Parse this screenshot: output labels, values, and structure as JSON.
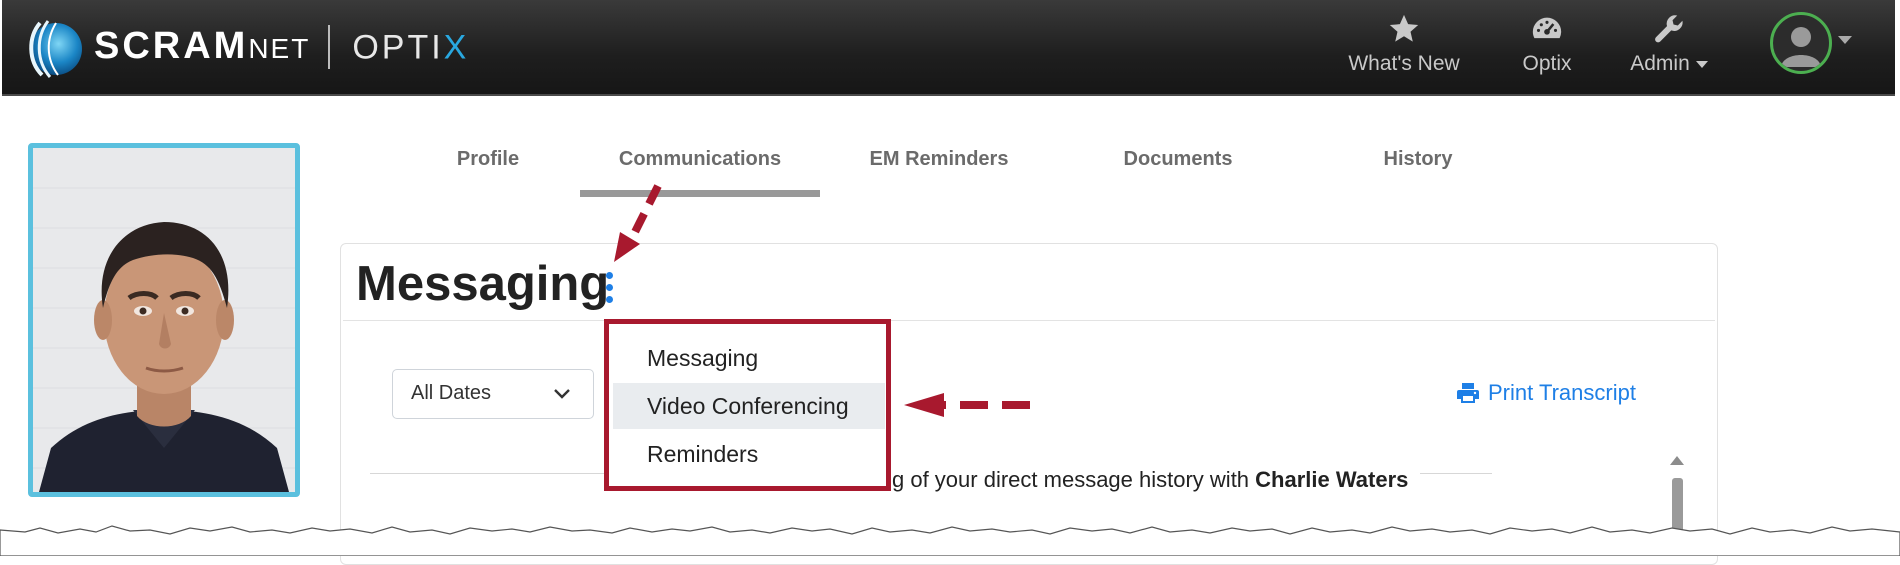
{
  "brand": {
    "name_primary": "SCRAM",
    "name_secondary": "NET",
    "product_prefix": "OPTI",
    "product_suffix": "X"
  },
  "topnav": {
    "items": [
      {
        "label": "What's New",
        "icon": "star-icon"
      },
      {
        "label": "Optix",
        "icon": "dashboard-gauge-icon"
      },
      {
        "label": "Admin",
        "icon": "wrench-icon",
        "has_dropdown": true
      }
    ],
    "user_menu": {
      "icon": "user-avatar-icon",
      "status_color": "#4caf50"
    }
  },
  "tabs": [
    {
      "label": "Profile",
      "active": false
    },
    {
      "label": "Communications",
      "active": true
    },
    {
      "label": "EM Reminders",
      "active": false
    },
    {
      "label": "Documents",
      "active": false
    },
    {
      "label": "History",
      "active": false
    }
  ],
  "section": {
    "title": "Messaging",
    "options_icon": "kebab-menu-icon",
    "accent_color": "#1e7fe6"
  },
  "filters": {
    "date_range": {
      "selected": "All Dates"
    }
  },
  "actions": {
    "print_transcript": "Print Transcript",
    "print_icon": "printer-icon"
  },
  "history_note": {
    "text_before": "g of your direct message history with ",
    "contact_name": "Charlie Waters"
  },
  "dropdown_menu": {
    "items": [
      {
        "label": "Messaging",
        "highlighted": false
      },
      {
        "label": "Video Conferencing",
        "highlighted": true
      },
      {
        "label": "Reminders",
        "highlighted": false
      }
    ],
    "callout_color": "#a8192e"
  },
  "profile_photo": {
    "icon": "person-photo"
  }
}
